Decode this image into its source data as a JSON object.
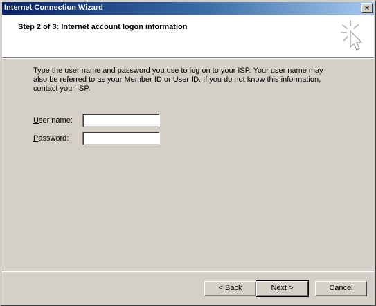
{
  "window": {
    "title": "Internet Connection Wizard",
    "close_glyph": "×"
  },
  "header": {
    "title": "Step 2 of 3: Internet account logon information",
    "icon": "wizard-cursor-icon"
  },
  "instructions": "Type the user name and password you use to log on to your ISP. Your user name may also be referred to as your Member ID or User ID. If you do not know this information, contact your ISP.",
  "fields": {
    "username": {
      "label_access": "U",
      "label_rest": "ser name:",
      "value": ""
    },
    "password": {
      "label_access": "P",
      "label_rest": "assword:",
      "value": ""
    }
  },
  "buttons": {
    "back": {
      "prefix": "< ",
      "access": "B",
      "rest": "ack"
    },
    "next": {
      "access": "N",
      "rest": "ext >"
    },
    "cancel": {
      "label": "Cancel"
    }
  }
}
